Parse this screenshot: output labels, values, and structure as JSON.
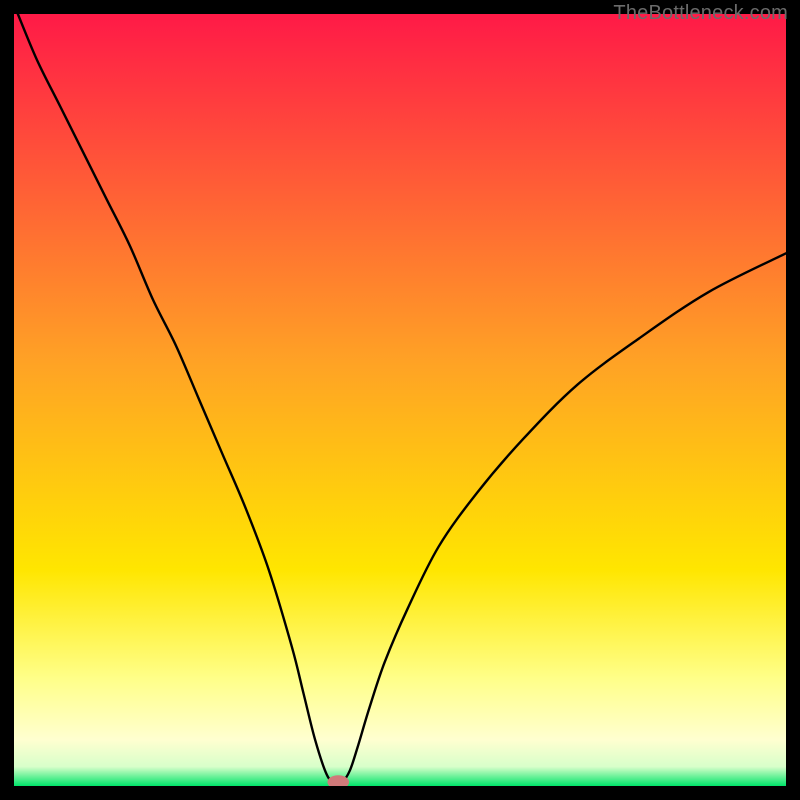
{
  "watermark": "TheBottleneck.com",
  "chart_data": {
    "type": "line",
    "title": "",
    "xlabel": "",
    "ylabel": "",
    "xlim": [
      0,
      100
    ],
    "ylim": [
      0,
      100
    ],
    "background_gradient": {
      "stops": [
        {
          "pos": 0.0,
          "color": "#ff1a47"
        },
        {
          "pos": 0.45,
          "color": "#ffa225"
        },
        {
          "pos": 0.72,
          "color": "#ffe600"
        },
        {
          "pos": 0.86,
          "color": "#ffff88"
        },
        {
          "pos": 0.94,
          "color": "#ffffd0"
        },
        {
          "pos": 0.975,
          "color": "#d8ffca"
        },
        {
          "pos": 1.0,
          "color": "#00e46a"
        }
      ]
    },
    "series": [
      {
        "name": "bottleneck-curve",
        "x": [
          0.5,
          3,
          6,
          9,
          12,
          15,
          18,
          21,
          24,
          27,
          30,
          33,
          36,
          37.5,
          39,
          40.5,
          41.5,
          42.5,
          43.5,
          44.5,
          46,
          48,
          51,
          55,
          60,
          66,
          73,
          81,
          90,
          100
        ],
        "y": [
          100,
          94,
          88,
          82,
          76,
          70,
          63,
          57,
          50,
          43,
          36,
          28,
          18,
          12,
          6,
          1.5,
          0.5,
          0.5,
          2,
          5,
          10,
          16,
          23,
          31,
          38,
          45,
          52,
          58,
          64,
          69
        ]
      }
    ],
    "marker": {
      "name": "bottleneck-point",
      "x": 42,
      "y": 0.5,
      "color": "#d07a7a",
      "rx": 1.4,
      "ry": 0.9
    }
  }
}
